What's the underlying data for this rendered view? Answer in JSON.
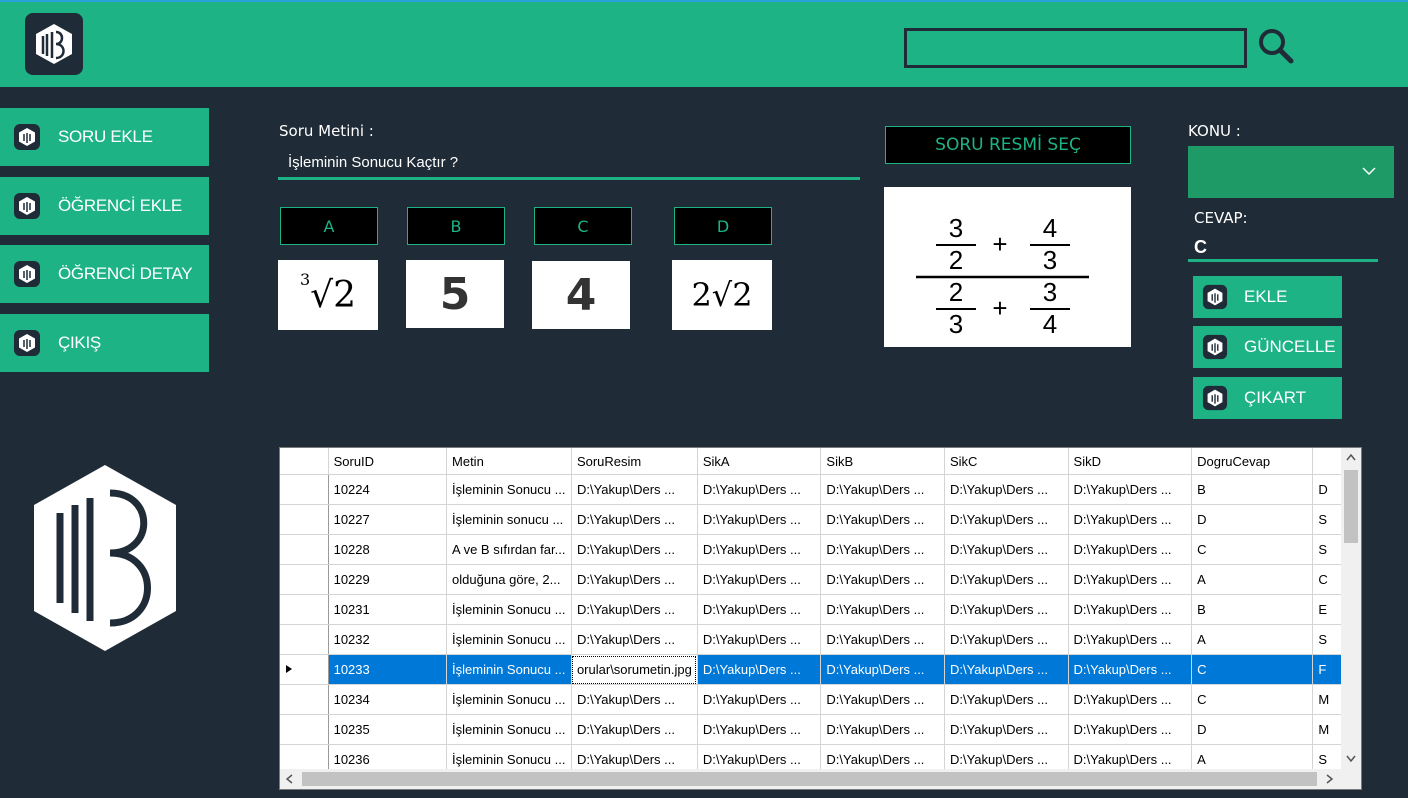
{
  "header": {
    "search": {
      "value": "",
      "placeholder": ""
    }
  },
  "sidebar": {
    "items": [
      {
        "label": "SORU EKLE"
      },
      {
        "label": "ÖĞRENCİ EKLE"
      },
      {
        "label": "ÖĞRENCİ DETAY"
      },
      {
        "label": "ÇIKIŞ"
      }
    ]
  },
  "form": {
    "question_label": "Soru Metini :",
    "question_value": "İşleminin Sonucu Kaçtır ?",
    "options": [
      {
        "label": "A"
      },
      {
        "label": "B"
      },
      {
        "label": "C"
      },
      {
        "label": "D"
      }
    ],
    "option_images": [
      "3",
      "√2",
      "5",
      "4",
      "2√2"
    ],
    "select_image_label": "SORU RESMİ SEÇ",
    "question_image": {
      "n1": "3",
      "d1": "2",
      "n2": "4",
      "d2": "3",
      "n3": "2",
      "d3": "3",
      "n4": "3",
      "d4": "4",
      "op": "+"
    },
    "topic_label": "KONU :",
    "topic_value": "",
    "answer_label": "CEVAP:",
    "answer_value": "C",
    "actions": [
      {
        "label": "EKLE"
      },
      {
        "label": "GÜNCELLE"
      },
      {
        "label": "ÇIKART"
      }
    ]
  },
  "grid": {
    "columns": [
      "SoruID",
      "Metin",
      "SoruResim",
      "SikA",
      "SikB",
      "SikC",
      "SikD",
      "DogruCevap"
    ],
    "rows": [
      [
        "10224",
        "İşleminin Sonucu ...",
        "D:\\Yakup\\Ders ...",
        "D:\\Yakup\\Ders ...",
        "D:\\Yakup\\Ders ...",
        "D:\\Yakup\\Ders ...",
        "D:\\Yakup\\Ders ...",
        "B",
        "D"
      ],
      [
        "10227",
        "İşleminin sonucu ...",
        "D:\\Yakup\\Ders ...",
        "D:\\Yakup\\Ders ...",
        "D:\\Yakup\\Ders ...",
        "D:\\Yakup\\Ders ...",
        "D:\\Yakup\\Ders ...",
        "D",
        "S"
      ],
      [
        "10228",
        "A ve B sıfırdan far...",
        "D:\\Yakup\\Ders ...",
        "D:\\Yakup\\Ders ...",
        "D:\\Yakup\\Ders ...",
        "D:\\Yakup\\Ders ...",
        "D:\\Yakup\\Ders ...",
        "C",
        "S"
      ],
      [
        "10229",
        "olduğuna göre, 2...",
        "D:\\Yakup\\Ders ...",
        "D:\\Yakup\\Ders ...",
        "D:\\Yakup\\Ders ...",
        "D:\\Yakup\\Ders ...",
        "D:\\Yakup\\Ders ...",
        "A",
        "C"
      ],
      [
        "10231",
        "İşleminin Sonucu ...",
        "D:\\Yakup\\Ders ...",
        "D:\\Yakup\\Ders ...",
        "D:\\Yakup\\Ders ...",
        "D:\\Yakup\\Ders ...",
        "D:\\Yakup\\Ders ...",
        "B",
        "E"
      ],
      [
        "10232",
        "İşleminin Sonucu ...",
        "D:\\Yakup\\Ders ...",
        "D:\\Yakup\\Ders ...",
        "D:\\Yakup\\Ders ...",
        "D:\\Yakup\\Ders ...",
        "D:\\Yakup\\Ders ...",
        "A",
        "S"
      ],
      [
        "10233",
        "İşleminin Sonucu ...",
        "orular\\sorumetin.jpg",
        "D:\\Yakup\\Ders ...",
        "D:\\Yakup\\Ders ...",
        "D:\\Yakup\\Ders ...",
        "D:\\Yakup\\Ders ...",
        "C",
        "F"
      ],
      [
        "10234",
        "İşleminin Sonucu ...",
        "D:\\Yakup\\Ders ...",
        "D:\\Yakup\\Ders ...",
        "D:\\Yakup\\Ders ...",
        "D:\\Yakup\\Ders ...",
        "D:\\Yakup\\Ders ...",
        "C",
        "M"
      ],
      [
        "10235",
        "İşleminin Sonucu ...",
        "D:\\Yakup\\Ders ...",
        "D:\\Yakup\\Ders ...",
        "D:\\Yakup\\Ders ...",
        "D:\\Yakup\\Ders ...",
        "D:\\Yakup\\Ders ...",
        "D",
        "M"
      ],
      [
        "10236",
        "İşleminin Sonucu ...",
        "D:\\Yakup\\Ders ...",
        "D:\\Yakup\\Ders ...",
        "D:\\Yakup\\Ders ...",
        "D:\\Yakup\\Ders ...",
        "D:\\Yakup\\Ders ...",
        "A",
        "S"
      ]
    ],
    "selected_row": 6
  },
  "colors": {
    "accent": "#1db385",
    "background": "#1f2b36",
    "selection": "#0078d7"
  },
  "icons": [
    "msb-logo",
    "search-icon",
    "cube-icon",
    "chevron-down-icon",
    "row-pointer-icon"
  ]
}
